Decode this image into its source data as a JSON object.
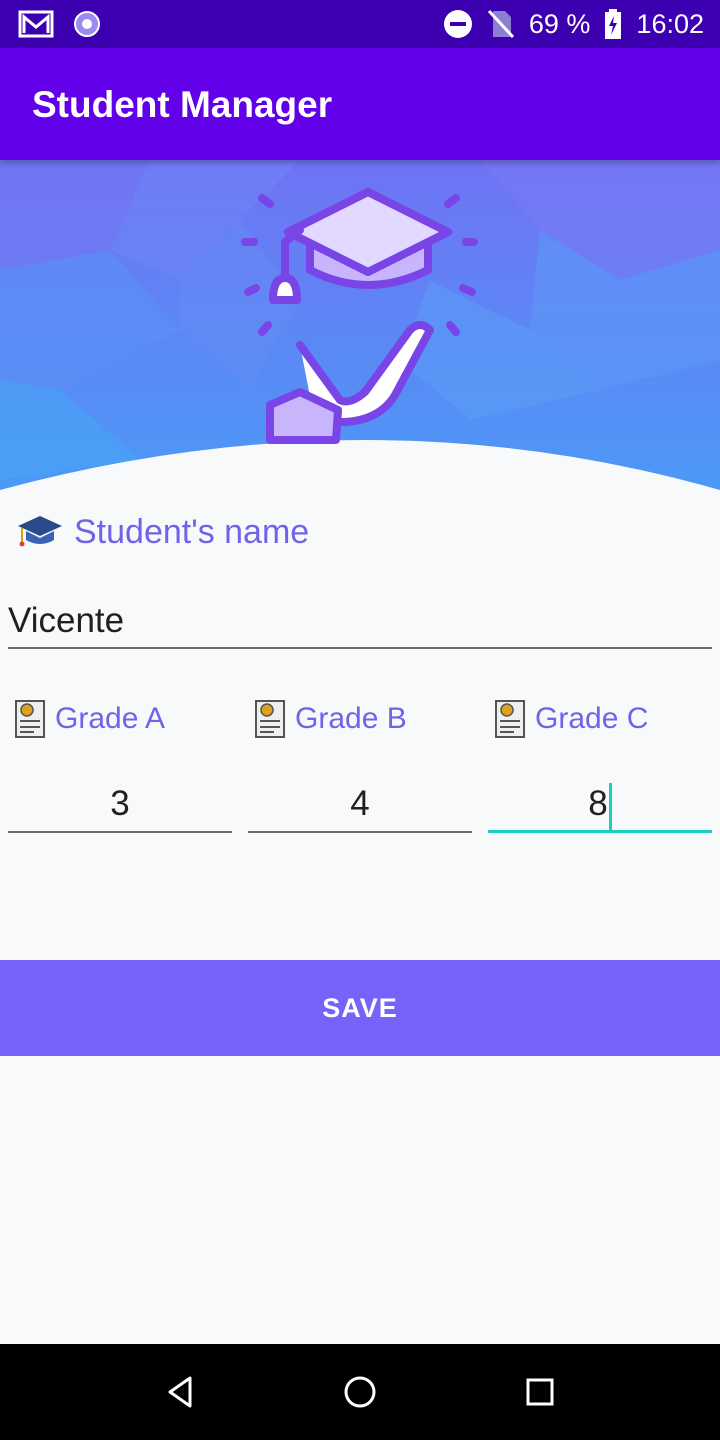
{
  "status_bar": {
    "battery": "69 %",
    "time": "16:02",
    "icons": [
      "gmail-icon",
      "sync-icon",
      "do-not-disturb-icon",
      "no-sim-icon",
      "battery-charging-icon"
    ]
  },
  "app_bar": {
    "title": "Student Manager"
  },
  "hero": {
    "icon": "graduation-cap-on-hand-illustration"
  },
  "form": {
    "name_label": "Student's name",
    "name_value": "Vicente",
    "grades": [
      {
        "label": "Grade A",
        "value": "3"
      },
      {
        "label": "Grade B",
        "value": "4"
      },
      {
        "label": "Grade C",
        "value": "8"
      }
    ],
    "save_label": "SAVE"
  },
  "nav_bar": {
    "icons": [
      "back-icon",
      "home-icon",
      "recents-icon"
    ]
  },
  "colors": {
    "status_bar": "#3d00b0",
    "app_bar": "#6200ea",
    "accent": "#7563fa",
    "label": "#7163e8",
    "focus": "#17d0c0"
  }
}
